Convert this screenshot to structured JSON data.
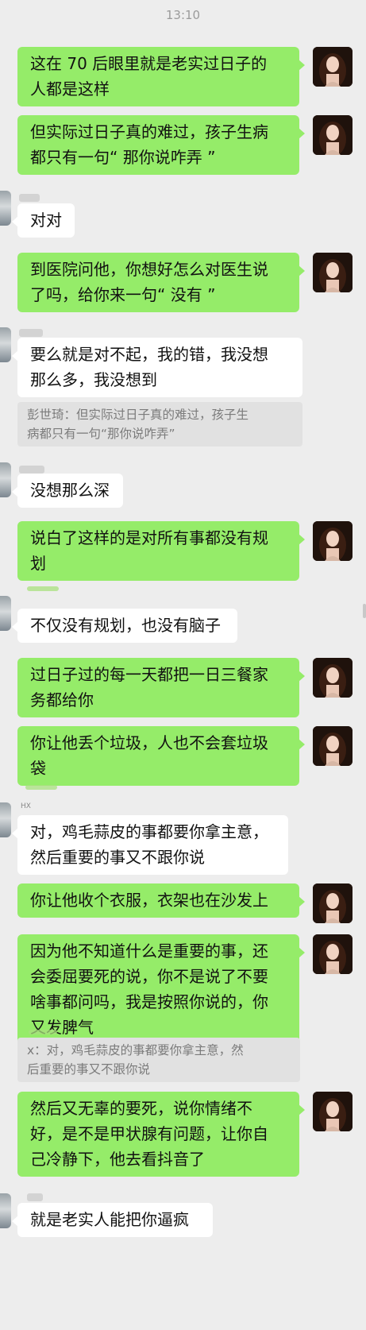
{
  "status": {
    "time": "13:10"
  },
  "messages": [
    {
      "id": "m1",
      "side": "me",
      "text": "这在 70 后眼里就是老实过日子的\n人都是这样"
    },
    {
      "id": "m2",
      "side": "me",
      "text": "但实际过日子真的难过，孩子生病\n都只有一句“ 那你说咋弄 ”"
    },
    {
      "id": "m3",
      "side": "other",
      "text": "对对"
    },
    {
      "id": "m4",
      "side": "me",
      "text": "到医院问他，你想好怎么对医生说\n了吗，给你来一句“ 没有 ”"
    },
    {
      "id": "m5",
      "side": "other",
      "text": "要么就是对不起，我的错，我没想\n那么多，我没想到"
    },
    {
      "id": "q1",
      "side": "quote",
      "text": "彭世琦：但实际过日子真的难过，孩子生\n病都只有一句“那你说咋弄”"
    },
    {
      "id": "m6",
      "side": "other",
      "text": "没想那么深"
    },
    {
      "id": "m7",
      "side": "me",
      "text": "说白了这样的是对所有事都没有规\n划"
    },
    {
      "id": "m8",
      "side": "other",
      "text": "不仅没有规划，也没有脑子"
    },
    {
      "id": "m9",
      "side": "me",
      "text": "过日子过的每一天都把一日三餐家\n务都给你"
    },
    {
      "id": "m10",
      "side": "me",
      "text": "你让他丢个垃圾，人也不会套垃圾\n袋"
    },
    {
      "id": "m11",
      "side": "other",
      "sender": "HX",
      "text": "对，鸡毛蒜皮的事都要你拿主意，\n然后重要的事又不跟你说"
    },
    {
      "id": "m12",
      "side": "me",
      "text": "你让他收个衣服，衣架也在沙发上"
    },
    {
      "id": "m13",
      "side": "me",
      "text": "因为他不知道什么是重要的事，还\n会委屈要死的说，你不是说了不要\n啥事都问吗，我是按照你说的，你\n又发脾气"
    },
    {
      "id": "q2",
      "side": "quote",
      "text": "x：对，鸡毛蒜皮的事都要你拿主意，然\n后重要的事又不跟你说"
    },
    {
      "id": "m14",
      "side": "me",
      "text": "然后又无辜的要死，说你情绪不\n好，是不是甲状腺有问题，让你自\n己冷静下，他去看抖音了"
    },
    {
      "id": "m15",
      "side": "other",
      "text": "就是老实人能把你逼疯"
    }
  ]
}
